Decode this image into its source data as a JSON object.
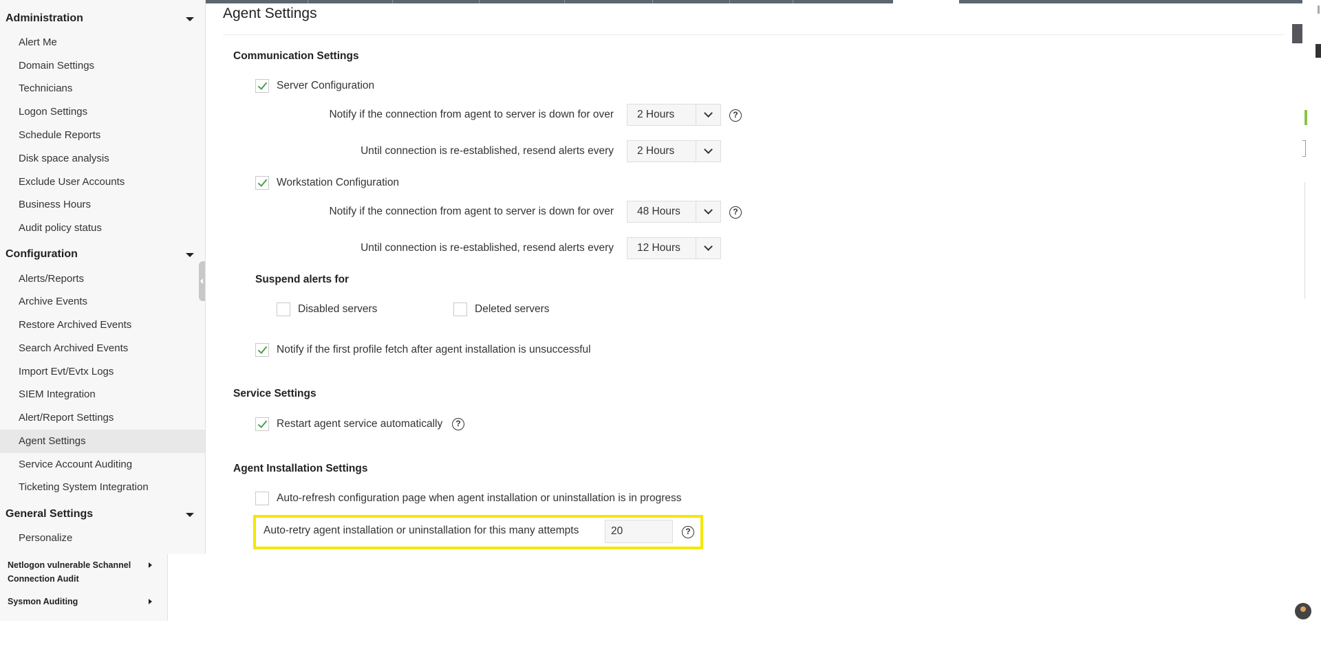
{
  "page_title": "Agent Settings",
  "sidebar": {
    "administration": {
      "label": "Administration",
      "items": [
        "Alert Me",
        "Domain Settings",
        "Technicians",
        "Logon Settings",
        "Schedule Reports",
        "Disk space analysis",
        "Exclude User Accounts",
        "Business Hours",
        "Audit policy status"
      ]
    },
    "configuration": {
      "label": "Configuration",
      "items": [
        "Alerts/Reports",
        "Archive Events",
        "Restore Archived Events",
        "Search Archived Events",
        "Import Evt/Evtx Logs",
        "SIEM Integration",
        "Alert/Report Settings",
        "Agent Settings",
        "Service Account Auditing",
        "Ticketing System Integration"
      ],
      "active_item": "Agent Settings"
    },
    "general": {
      "label": "General Settings",
      "items": [
        "Personalize"
      ]
    },
    "sub_items": [
      "Netlogon vulnerable Schannel Connection Audit",
      "Sysmon Auditing"
    ]
  },
  "communication": {
    "title": "Communication Settings",
    "server_config": {
      "label": "Server Configuration",
      "checked": true,
      "notify_label": "Notify if the connection from agent to server is down for over",
      "notify_value": "2 Hours",
      "resend_label": "Until connection is re-established, resend alerts every",
      "resend_value": "2 Hours"
    },
    "workstation_config": {
      "label": "Workstation Configuration",
      "checked": true,
      "notify_label": "Notify if the connection from agent to server is down for over",
      "notify_value": "48 Hours",
      "resend_label": "Until connection is re-established, resend alerts every",
      "resend_value": "12 Hours"
    },
    "suspend": {
      "label": "Suspend alerts for",
      "disabled_servers": "Disabled servers",
      "deleted_servers": "Deleted servers"
    },
    "profile_fetch": "Notify if the first profile fetch after agent installation is unsuccessful"
  },
  "service": {
    "title": "Service Settings",
    "restart": "Restart agent service automatically"
  },
  "installation": {
    "title": "Agent Installation Settings",
    "auto_refresh": "Auto-refresh configuration page when agent installation or uninstallation is in progress",
    "auto_retry_label": "Auto-retry agent installation or uninstallation for this many attempts",
    "auto_retry_value": "20"
  },
  "icons": {
    "help": "?",
    "highlight_color": "#f3e800",
    "check_color": "#4aa04a"
  }
}
